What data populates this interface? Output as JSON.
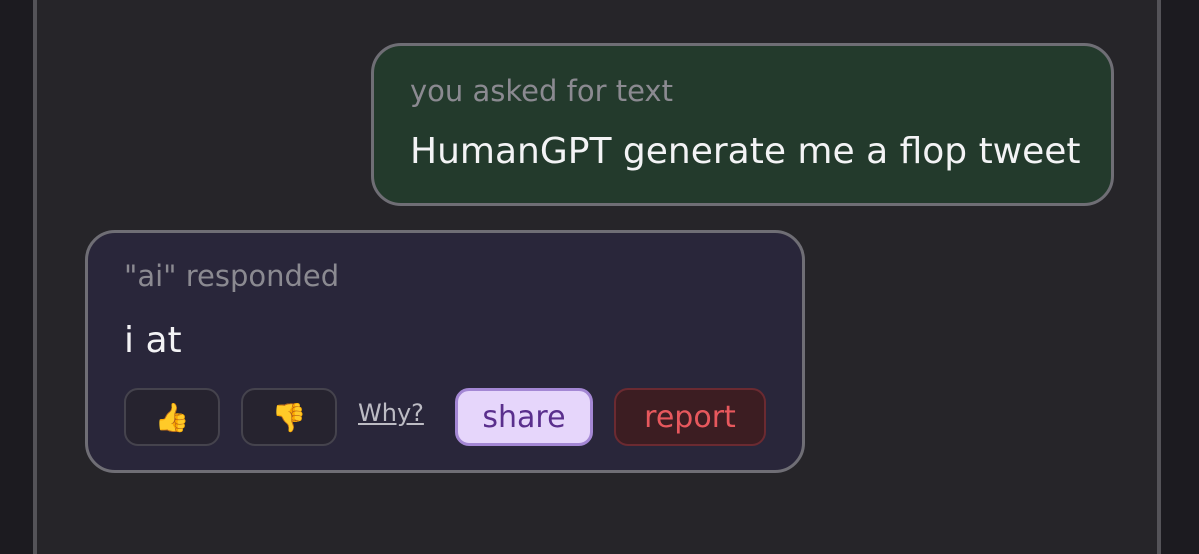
{
  "user_message": {
    "caption": "you asked for text",
    "text": "HumanGPT generate me a flop tweet"
  },
  "ai_message": {
    "caption": "\"ai\" responded",
    "text": "i at",
    "actions": {
      "thumbs_up": "👍",
      "thumbs_down": "👎",
      "why_label": "Why?",
      "share_label": "share",
      "report_label": "report"
    }
  },
  "colors": {
    "page_background": "#1c1b20",
    "panel_background": "#262529",
    "user_bubble": "#233a2c",
    "ai_bubble": "#29263a",
    "share_bg": "#e6d6fb",
    "share_text": "#5a2f8d",
    "report_bg": "#3c1d22",
    "report_text": "#e7585d"
  },
  "icons": {
    "thumbs_up": "thumbs-up-icon",
    "thumbs_down": "thumbs-down-icon"
  }
}
